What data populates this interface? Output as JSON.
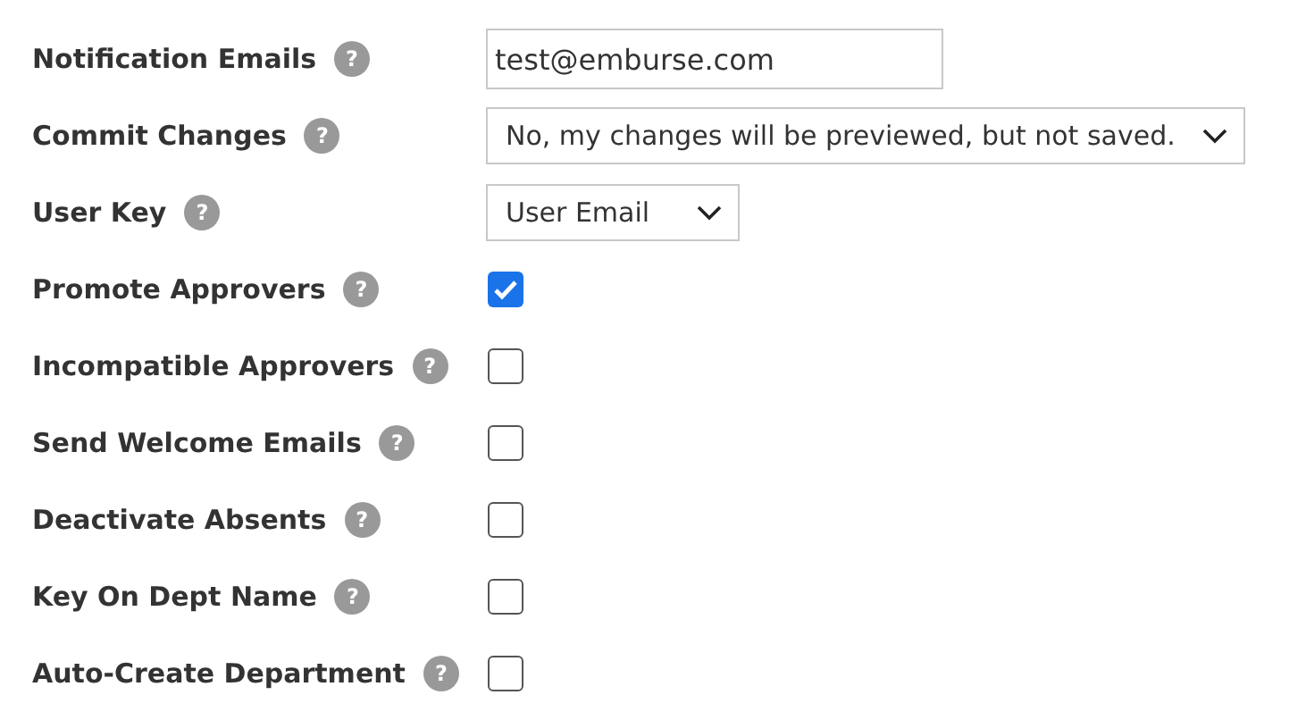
{
  "settings": [
    {
      "label": "Notification Emails",
      "help": "?",
      "kind": "text",
      "value": "test@emburse.com"
    },
    {
      "label": "Commit Changes",
      "help": "?",
      "kind": "select",
      "value": "No, my changes will be previewed, but not saved."
    },
    {
      "label": "User Key",
      "help": "?",
      "kind": "select",
      "value": "User Email"
    },
    {
      "label": "Promote Approvers",
      "help": "?",
      "kind": "checkbox",
      "checked": true
    },
    {
      "label": "Incompatible Approvers",
      "help": "?",
      "kind": "checkbox",
      "checked": false
    },
    {
      "label": "Send Welcome Emails",
      "help": "?",
      "kind": "checkbox",
      "checked": false
    },
    {
      "label": "Deactivate Absents",
      "help": "?",
      "kind": "checkbox",
      "checked": false
    },
    {
      "label": "Key On Dept Name",
      "help": "?",
      "kind": "checkbox",
      "checked": false
    },
    {
      "label": "Auto-Create Department",
      "help": "?",
      "kind": "checkbox",
      "checked": false
    }
  ]
}
